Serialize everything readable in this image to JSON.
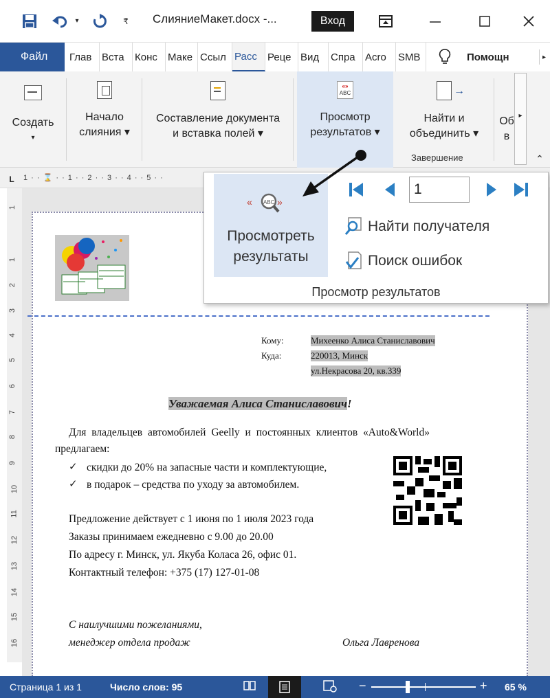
{
  "titlebar": {
    "document_name": "СлияниеМакет.docx -...",
    "signin_label": "Вход"
  },
  "tabs": [
    "Файл",
    "Глав",
    "Вста",
    "Конс",
    "Маке",
    "Ссыл",
    "Расс",
    "Реце",
    "Вид",
    "Спра",
    "Acro",
    "SMB",
    "Помощн"
  ],
  "ribbon": {
    "create": "Создать",
    "start_merge": [
      "Начало",
      "слияния ▾"
    ],
    "compose": [
      "Составление документа",
      "и вставка полей ▾"
    ],
    "preview": [
      "Просмотр",
      "результатов ▾"
    ],
    "finish": [
      "Найти и",
      "объединить ▾"
    ],
    "finish_group": "Завершение",
    "more": [
      "Об",
      "в"
    ]
  },
  "popup": {
    "preview_button": [
      "Просмотреть",
      "результаты"
    ],
    "record_value": "1",
    "find_recipient": "Найти получателя",
    "check_errors": "Поиск ошибок",
    "group_label": "Просмотр результатов"
  },
  "ruler_text": "1 · · ⌛ · · 1 · · 2 · · 3 · · 4 · · 5 · ·",
  "vruler_numbers": [
    "1",
    "1",
    "2",
    "3",
    "4",
    "5",
    "6",
    "7",
    "8",
    "9",
    "10",
    "11",
    "12",
    "13",
    "14",
    "15",
    "16"
  ],
  "letter": {
    "to_label": "Кому:",
    "to_value": "Михеенко Алиса Станиславович",
    "where_label": "Куда:",
    "where_value1": "220013, Минск",
    "where_value2": "ул.Некрасова 20, кв.339",
    "greeting_prefix": "Уважаемая Алиса Станиславович",
    "greeting_suffix": "!",
    "intro_line1": "Для владельцев автомобилей Geelly и постоянных клиентов «Auto&World»",
    "intro_line2": "предлагаем:",
    "bullet1": "скидки до 20% на запасные части и комплектующие,",
    "bullet2": "в подарок – средства по уходу за автомобилем.",
    "info1": "Предложение действует с 1 июня по 1 июля 2023 года",
    "info2": "Заказы принимаем ежедневно с 9.00 до 20.00",
    "info3": "По адресу г. Минск, ул. Якуба Коласа 26, офис 01.",
    "info4": "Контактный телефон: +375 (17) 127-01-08",
    "closing1": "С наилучшими пожеланиями,",
    "closing2": "менеджер отдела продаж",
    "signature": "Ольга Лавренова"
  },
  "status": {
    "page": "Страница 1 из 1",
    "words": "Число слов: 95",
    "zoom": "65 %"
  },
  "colors": {
    "accent": "#2b579a",
    "field_shade": "#bdbdbd"
  }
}
